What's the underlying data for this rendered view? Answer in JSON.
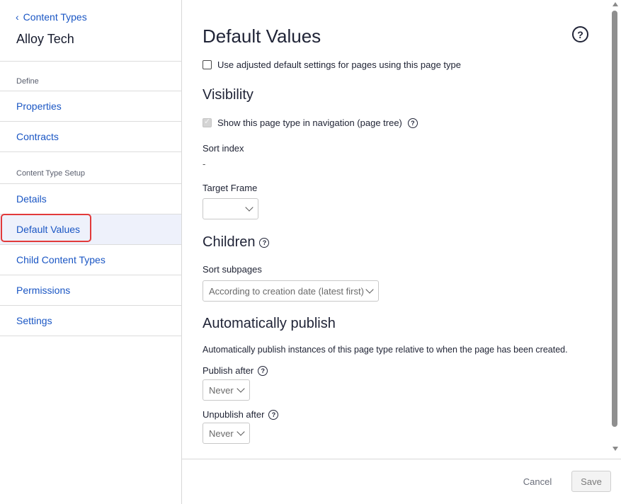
{
  "sidebar": {
    "back_label": "Content Types",
    "title": "Alloy Tech",
    "section_define": "Define",
    "section_setup": "Content Type Setup",
    "items": [
      {
        "label": "Properties"
      },
      {
        "label": "Contracts"
      },
      {
        "label": "Details"
      },
      {
        "label": "Default Values",
        "active": true
      },
      {
        "label": "Child Content Types"
      },
      {
        "label": "Permissions"
      },
      {
        "label": "Settings"
      }
    ]
  },
  "main": {
    "title": "Default Values",
    "adjusted_checkbox_label": "Use adjusted default settings for pages using this page type",
    "visibility": {
      "heading": "Visibility",
      "show_in_nav_label": "Show this page type in navigation (page tree)",
      "show_in_nav_checked": true,
      "sort_index_label": "Sort index",
      "sort_index_value": "-",
      "target_frame_label": "Target Frame",
      "target_frame_value": ""
    },
    "children": {
      "heading": "Children",
      "sort_subpages_label": "Sort subpages",
      "sort_subpages_value": "According to creation date (latest first)"
    },
    "auto_publish": {
      "heading": "Automatically publish",
      "description": "Automatically publish instances of this page type relative to when the page has been created.",
      "publish_after_label": "Publish after",
      "publish_after_value": "Never",
      "unpublish_after_label": "Unpublish after",
      "unpublish_after_value": "Never"
    }
  },
  "footer": {
    "cancel_label": "Cancel",
    "save_label": "Save"
  },
  "colors": {
    "link": "#1a56c4",
    "active_bg": "#eef1fb",
    "highlight": "#e23a3a"
  }
}
